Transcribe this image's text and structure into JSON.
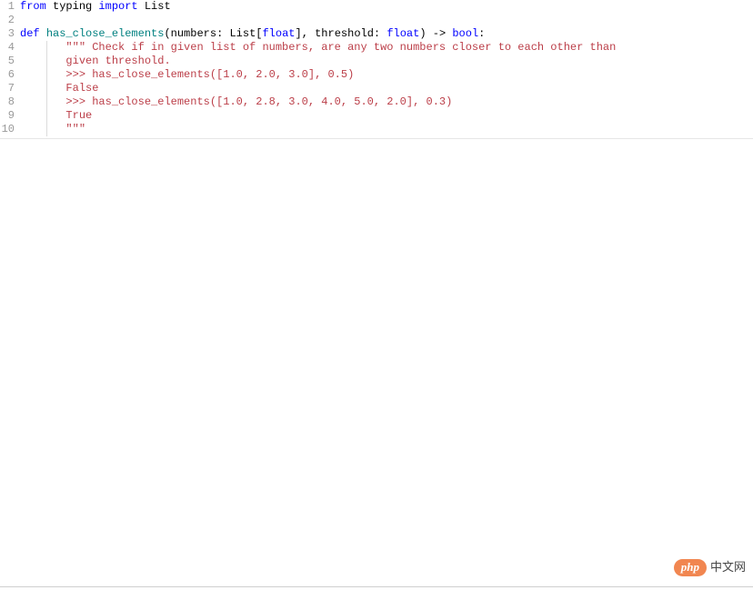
{
  "code": {
    "lines": [
      {
        "num": "1",
        "indent": 0,
        "guide": false,
        "tokens": [
          {
            "cls": "kw-blue",
            "t": "from"
          },
          {
            "cls": "ident",
            "t": " typing "
          },
          {
            "cls": "kw-blue",
            "t": "import"
          },
          {
            "cls": "ident",
            "t": " List"
          }
        ]
      },
      {
        "num": "2",
        "indent": 0,
        "guide": false,
        "tokens": []
      },
      {
        "num": "3",
        "indent": 0,
        "guide": false,
        "tokens": [
          {
            "cls": "kw-blue",
            "t": "def "
          },
          {
            "cls": "kw-teal",
            "t": "has_close_elements"
          },
          {
            "cls": "paren",
            "t": "("
          },
          {
            "cls": "ident",
            "t": "numbers"
          },
          {
            "cls": "punct",
            "t": ": "
          },
          {
            "cls": "ident",
            "t": "List"
          },
          {
            "cls": "punct",
            "t": "["
          },
          {
            "cls": "kw-blue",
            "t": "float"
          },
          {
            "cls": "punct",
            "t": "], "
          },
          {
            "cls": "ident",
            "t": "threshold"
          },
          {
            "cls": "punct",
            "t": ": "
          },
          {
            "cls": "kw-blue",
            "t": "float"
          },
          {
            "cls": "paren",
            "t": ")"
          },
          {
            "cls": "punct",
            "t": " -> "
          },
          {
            "cls": "kw-blue",
            "t": "bool"
          },
          {
            "cls": "punct",
            "t": ":"
          }
        ]
      },
      {
        "num": "4",
        "indent": 1,
        "guide": true,
        "tokens": [
          {
            "cls": "doc-string",
            "t": "\"\"\" Check if in given list of numbers, are any two numbers closer to each other than"
          }
        ]
      },
      {
        "num": "5",
        "indent": 1,
        "guide": true,
        "tokens": [
          {
            "cls": "doc-string",
            "t": "given threshold."
          }
        ]
      },
      {
        "num": "6",
        "indent": 1,
        "guide": true,
        "tokens": [
          {
            "cls": "doc-string",
            "t": ">>> has_close_elements([1.0, 2.0, 3.0], 0.5)"
          }
        ]
      },
      {
        "num": "7",
        "indent": 1,
        "guide": true,
        "tokens": [
          {
            "cls": "doc-string",
            "t": "False"
          }
        ]
      },
      {
        "num": "8",
        "indent": 1,
        "guide": true,
        "tokens": [
          {
            "cls": "doc-string",
            "t": ">>> has_close_elements([1.0, 2.8, 3.0, 4.0, 5.0, 2.0], 0.3)"
          }
        ]
      },
      {
        "num": "9",
        "indent": 1,
        "guide": true,
        "tokens": [
          {
            "cls": "doc-string",
            "t": "True"
          }
        ]
      },
      {
        "num": "10",
        "indent": 1,
        "guide": true,
        "tokens": [
          {
            "cls": "doc-string",
            "t": "\"\"\""
          }
        ]
      }
    ]
  },
  "watermark": {
    "logo_text": "php",
    "brand_text": "中文网"
  }
}
